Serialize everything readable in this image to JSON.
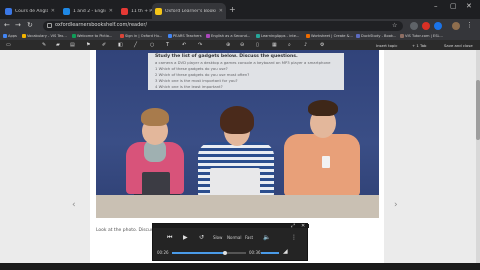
{
  "tabs": [
    {
      "title": "Cours de Anglais (B) - Interactive",
      "color": "#3b78e7",
      "active": false
    },
    {
      "title": "1 and 2 - English File third edit",
      "color": "#1e88e5",
      "active": false
    },
    {
      "title": "11 th + P - English Worksheet (Cover",
      "color": "#e53935",
      "active": false
    },
    {
      "title": "Oxford Learner's Bookshelf",
      "color": "#f5c518",
      "active": true
    }
  ],
  "address": {
    "url": "oxfordlearnersbookshelf.com/reader/"
  },
  "bookmarks": [
    {
      "label": "Apps",
      "color": "#4285f4"
    },
    {
      "label": "Vocabulary - VIS Tex...",
      "color": "#f4b400"
    },
    {
      "label": "Welcome to Pictio...",
      "color": "#0f9d58"
    },
    {
      "label": "Sign in | Oxford Hu...",
      "color": "#db4437"
    },
    {
      "label": "PEARS Teachers",
      "color": "#4285f4"
    },
    {
      "label": "English as a Second...",
      "color": "#ab47bc"
    },
    {
      "label": "LearningApps - inte...",
      "color": "#26a69a"
    },
    {
      "label": "Worksheet | Create &...",
      "color": "#ef6c00"
    },
    {
      "label": "DuckStudy - Book...",
      "color": "#5c6bc0"
    },
    {
      "label": "VIS Tutor.com | ESL...",
      "color": "#8d6e63"
    }
  ],
  "reader_toolbar": {
    "right_items": [
      "Insert topic",
      "+ 1 Tab",
      "Save and close"
    ]
  },
  "questions": {
    "heading": "Study the list of gadgets below. Discuss the questions.",
    "lines": [
      "a  camera   a DVD player   a desktop   a games console   a keyboard   an MP3 player   a smartphone",
      "1  Which of these gadgets do you use?",
      "2  Which of these gadgets do you use most often?",
      "3  Which one is the most important for you?",
      "4  Which one is the least important?"
    ]
  },
  "caption": "Look at the photo. Discuss what they are doing with the technology.",
  "media": {
    "rate_label": "Slow",
    "normal_label": "Normal",
    "fast_label": "Fast",
    "time_current": "00:26",
    "time_total": "00:36",
    "progress": 0.72
  }
}
